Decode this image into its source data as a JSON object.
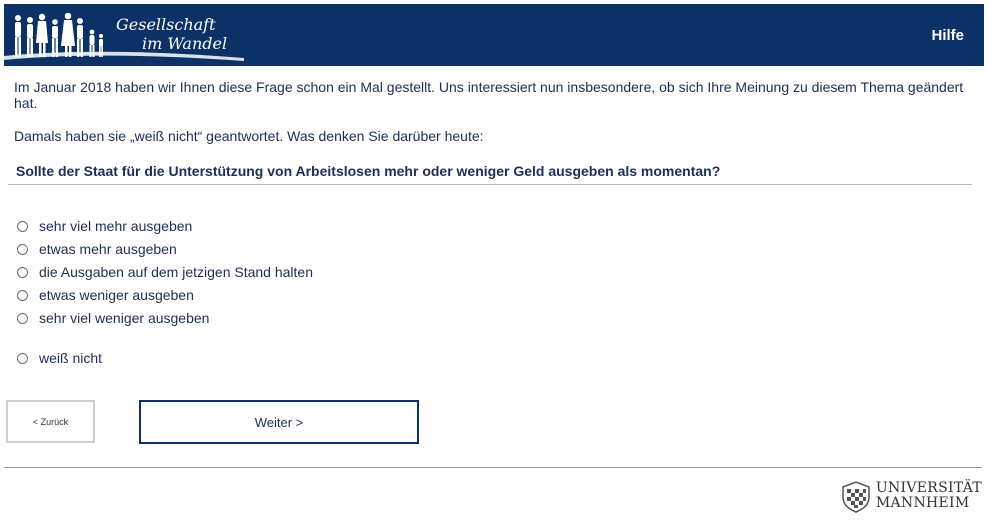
{
  "header": {
    "logo_line1": "Gesellschaft",
    "logo_line2": "im Wandel",
    "help_label": "Hilfe"
  },
  "intro_text": "Im Januar 2018 haben wir Ihnen diese Frage schon ein Mal gestellt. Uns interessiert nun insbesondere, ob sich Ihre Meinung zu diesem Thema geändert hat.",
  "previous_answer_text": "Damals haben sie „weiß nicht“ geantwortet. Was denken Sie darüber heute:",
  "question": "Sollte der Staat für die Unterstützung von Arbeitslosen mehr oder weniger Geld ausgeben als momentan?",
  "options": [
    {
      "label": "sehr viel mehr ausgeben"
    },
    {
      "label": "etwas mehr ausgeben"
    },
    {
      "label": "die Ausgaben auf dem jetzigen Stand halten"
    },
    {
      "label": "etwas weniger ausgeben"
    },
    {
      "label": "sehr viel weniger ausgeben"
    },
    {
      "label": "weiß nicht"
    }
  ],
  "nav": {
    "back_label": "< Zurück",
    "next_label": "Weiter >"
  },
  "footer": {
    "uni_line1": "UNIVERSITÄT",
    "uni_line2": "MANNHEIM"
  },
  "colors": {
    "header_bg": "#0c3166",
    "text": "#1f2d56",
    "next_border": "#0c3166"
  }
}
